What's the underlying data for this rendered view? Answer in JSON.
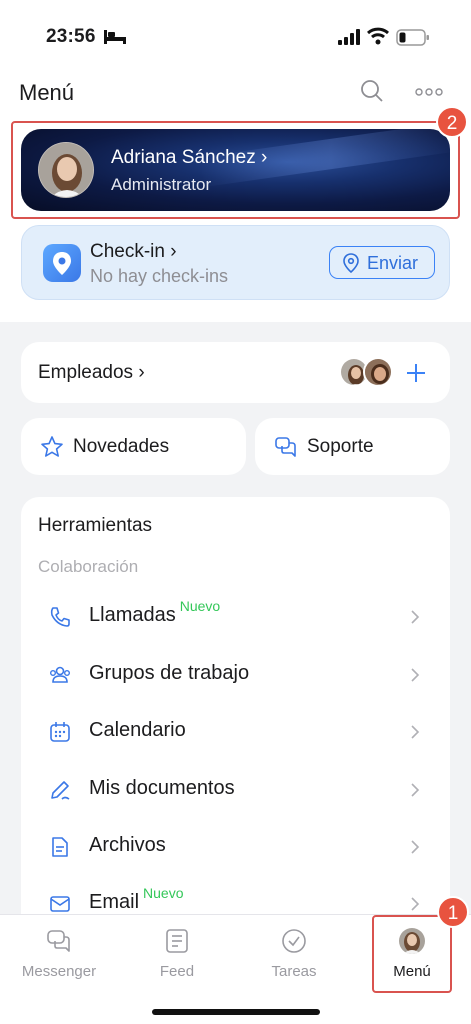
{
  "status_bar": {
    "time": "23:56"
  },
  "header": {
    "title": "Menú"
  },
  "profile": {
    "name": "Adriana Sánchez",
    "role": "Administrator"
  },
  "checkin": {
    "title": "Check-in",
    "subtitle": "No hay check-ins",
    "send_label": "Enviar"
  },
  "employees": {
    "label": "Empleados"
  },
  "quick_links": [
    {
      "label": "Novedades"
    },
    {
      "label": "Soporte"
    }
  ],
  "tools": {
    "title": "Herramientas",
    "section": "Colaboración",
    "items": [
      {
        "label": "Llamadas",
        "badge": "Nuevo",
        "icon": "phone-icon"
      },
      {
        "label": "Grupos de trabajo",
        "badge": "",
        "icon": "people-icon"
      },
      {
        "label": "Calendario",
        "badge": "",
        "icon": "calendar-icon"
      },
      {
        "label": "Mis documentos",
        "badge": "",
        "icon": "pen-icon"
      },
      {
        "label": "Archivos",
        "badge": "",
        "icon": "file-icon"
      },
      {
        "label": "Email",
        "badge": "Nuevo",
        "icon": "mail-icon"
      }
    ]
  },
  "tab_bar": [
    {
      "label": "Messenger",
      "icon": "chat-icon"
    },
    {
      "label": "Feed",
      "icon": "feed-icon"
    },
    {
      "label": "Tareas",
      "icon": "check-icon"
    },
    {
      "label": "Menú",
      "icon": "avatar"
    }
  ],
  "annotations": [
    "1",
    "2"
  ],
  "colors": {
    "accent": "#2f6fdb",
    "annotation": "#e8533f",
    "new_badge": "#34c759"
  }
}
